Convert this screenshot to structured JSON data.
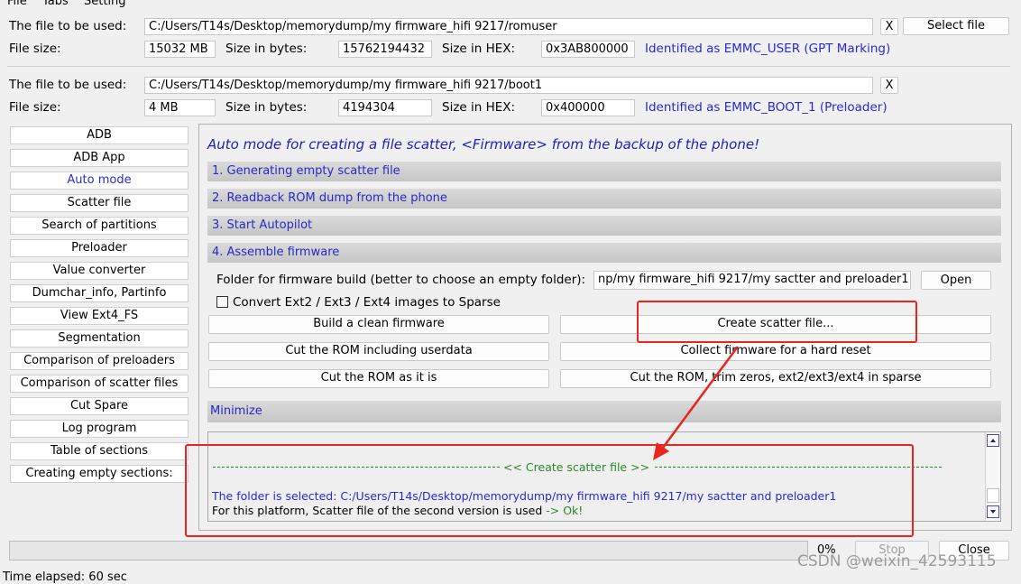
{
  "menu": {
    "items": [
      "File",
      "Tabs",
      "Setting"
    ]
  },
  "file1": {
    "label": "The file to be used:",
    "path": "C:/Users/T14s/Desktop/memorydump/my firmware_hifi 9217/romuser",
    "clear_label": "X",
    "select_label": "Select file",
    "size_label": "File size:",
    "size_value": "15032 MB",
    "bytes_label": "Size in bytes:",
    "bytes_value": "15762194432",
    "hex_label": "Size in HEX:",
    "hex_value": "0x3AB800000",
    "identified": "Identified as EMMC_USER (GPT Marking)"
  },
  "file2": {
    "label": "The file to be used:",
    "path": "C:/Users/T14s/Desktop/memorydump/my firmware_hifi 9217/boot1",
    "clear_label": "X",
    "size_label": "File size:",
    "size_value": "4 MB",
    "bytes_label": "Size in bytes:",
    "bytes_value": "4194304",
    "hex_label": "Size in HEX:",
    "hex_value": "0x400000",
    "identified": "Identified as EMMC_BOOT_1 (Preloader)"
  },
  "sidebar": {
    "items": [
      "ADB",
      "ADB App",
      "Auto mode",
      "Scatter file",
      "Search of partitions",
      "Preloader",
      "Value converter",
      "Dumchar_info, Partinfo",
      "View Ext4_FS",
      "Segmentation",
      "Comparison of preloaders",
      "Comparison of scatter files",
      "Cut Spare",
      "Log program",
      "Table of sections",
      "Creating empty sections:"
    ],
    "active": "Auto mode"
  },
  "main": {
    "title": "Auto mode for creating a file scatter, <Firmware> from the backup of the phone!",
    "sections": [
      "1. Generating empty scatter file",
      "2. Readback ROM dump from the phone",
      "3. Start Autopilot",
      "4. Assemble firmware"
    ],
    "folder_label": "Folder for firmware build (better to choose an empty folder):",
    "folder_value": "np/my firmware_hifi 9217/my sactter and preloader1",
    "open_label": "Open",
    "convert_label": "Convert Ext2 / Ext3 / Ext4 images to Sparse",
    "convert_checked": false,
    "buttons": {
      "build_clean": "Build a clean firmware",
      "create_scatter": "Create scatter file...",
      "cut_userdata": "Cut the ROM including userdata",
      "collect_hard_reset": "Collect firmware for a hard reset",
      "cut_as_is": "Cut the ROM as it is",
      "cut_trim": "Cut the ROM, trim zeros, ext2/ext3/ext4 in sparse"
    },
    "minimize": "Minimize"
  },
  "log": {
    "header": "<< Create scatter file >>",
    "folder_line": "The folder is selected:  C:/Users/T14s/Desktop/memorydump/my firmware_hifi 9217/my sactter and preloader1",
    "platform_line_prefix": "For this platform, Scatter file of the second version is used ",
    "platform_line_ok": "-> Ok!"
  },
  "footer": {
    "progress_percent": 0,
    "progress_text": "0%",
    "stop_label": "Stop",
    "close_label": "Close",
    "time_elapsed": "Time elapsed: 60 sec"
  },
  "watermark": "CSDN @weixin_42593115",
  "colors": {
    "accent_blue": "#2a2ad2",
    "annotation_red": "#e8251f",
    "log_green": "#2a8a2a"
  }
}
